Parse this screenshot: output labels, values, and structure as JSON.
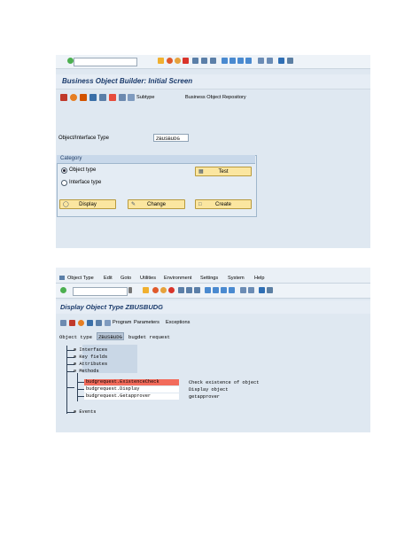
{
  "screen1": {
    "title": "Business Object Builder: Initial Screen",
    "app_toolbar": {
      "subtype_label": "Subtype",
      "repository_label": "Business Object Repository"
    },
    "field": {
      "label": "Object/Interface Type",
      "value": "ZBUSBUDG"
    },
    "category": {
      "title": "Category",
      "option_object": "Object type",
      "option_interface": "Interface type",
      "selected": "Object type"
    },
    "buttons": {
      "test": "Test",
      "display": "Display",
      "change": "Change",
      "create": "Create"
    }
  },
  "screen2": {
    "menu": [
      "Object Type",
      "Edit",
      "Goto",
      "Utilities",
      "Environment",
      "Settings",
      "System",
      "Help"
    ],
    "title": "Display Object Type ZBUSBUDG",
    "app_toolbar": {
      "program": "Program",
      "parameters": "Parameters",
      "exceptions": "Exceptions"
    },
    "object_type_label": "Object type",
    "object_type_value": "ZBUSBUDG",
    "object_type_desc": "bugdet request",
    "tree": {
      "interfaces": "Interfaces",
      "key_fields": "Key fields",
      "attributes": "Attributes",
      "methods": "Methods",
      "events": "Events"
    },
    "methods": [
      {
        "name": "budgrequest.ExistenceCheck",
        "desc": "Check existence of object",
        "selected": true
      },
      {
        "name": "budgrequest.Display",
        "desc": "Display object",
        "selected": false
      },
      {
        "name": "budgrequest.Getapprover",
        "desc": "getapprover",
        "selected": false
      }
    ],
    "colors": {
      "selected_row": "#f26b5b",
      "title": "#1a3a6b"
    }
  }
}
